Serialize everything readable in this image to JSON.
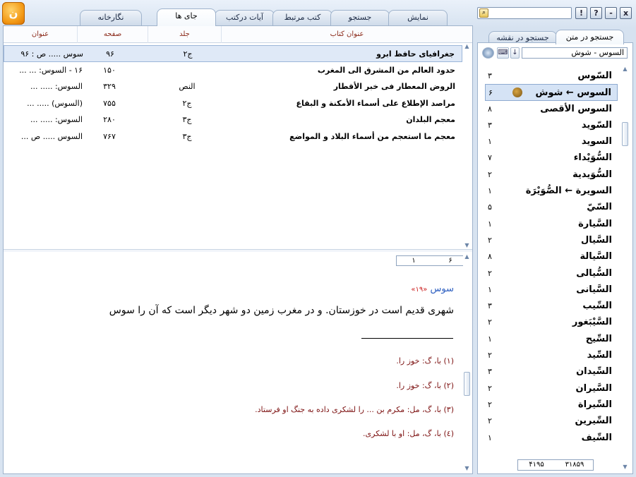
{
  "topbar": {
    "tabs": [
      {
        "label": "نمایش"
      },
      {
        "label": "جستجو"
      },
      {
        "label": "کتب مرتبط"
      },
      {
        "label": "آیات درکتب"
      },
      {
        "label": "جای ها"
      },
      {
        "label": "نگارخانه"
      }
    ],
    "search_placeholder": "",
    "buttons": {
      "info": "!",
      "help": "?",
      "minimize": "-",
      "close": "x"
    }
  },
  "table": {
    "columns": {
      "heading": "عنوان",
      "page": "صفحه",
      "volume": "جلد",
      "book_title": "عنوان کتاب"
    },
    "rows": [
      {
        "title": "جغرافیای حافظ ابرو",
        "volume": "ج۲",
        "page": "۹۶",
        "heading": "سوس ..... ص : ۹۶",
        "selected": true
      },
      {
        "title": "حدود العالم من المشرق الی المغرب",
        "volume": "",
        "page": "۱۵۰",
        "heading": "۱۶ - السوس: ... ..."
      },
      {
        "title": "الروض المعطار فی خبر الأقطار",
        "volume": "النص",
        "page": "۳۲۹",
        "heading": "السوس: ..... ..."
      },
      {
        "title": "مراصد الإطلاع علی أسماء الأمكنة و البقاع",
        "volume": "ج۲",
        "page": "۷۵۵",
        "heading": "(السوس) ..... ..."
      },
      {
        "title": "معجم البلدان",
        "volume": "ج۳",
        "page": "۲۸۰",
        "heading": "السوس: ..... ..."
      },
      {
        "title": "معجم ما استعجم من أسماء البلاد و المواضع",
        "volume": "ج۳",
        "page": "۷۶۷",
        "heading": "السوس ..... ص ..."
      }
    ]
  },
  "pager": {
    "current": "۱",
    "total": "۶"
  },
  "article": {
    "title": "سوس",
    "ref": "«۱۹»",
    "body": "شهری قدیم است در خوزستان. و در مغرب زمین دو شهر دیگر است که آن را سوس",
    "footnotes": [
      "(۱) با، گ: خوز را.",
      "(۲) با، گ: خوز را.",
      "(۳) با، گ، مل: مکرم بن ... را لشکری داده به جنگ او فرستاد.",
      "(٤) با، گ، مل: او با لشکری."
    ]
  },
  "right": {
    "tabs": [
      {
        "label": "جستجو در متن"
      },
      {
        "label": "جستجو در نقشه"
      }
    ],
    "search_value": "السوس - شوش",
    "words": [
      {
        "word": "السّوس",
        "count": "۳"
      },
      {
        "word": "السوس ← شوش",
        "count": "۶",
        "selected": true
      },
      {
        "word": "السوس الأقصی",
        "count": "۸"
      },
      {
        "word": "السّوید",
        "count": "۳"
      },
      {
        "word": "السوید",
        "count": "۱"
      },
      {
        "word": "السُّوَیْداء",
        "count": "۷"
      },
      {
        "word": "السُّوَیدیة",
        "count": "۲"
      },
      {
        "word": "السویرة ← الصُّوَیْرَة",
        "count": "۱"
      },
      {
        "word": "السّيّ",
        "count": "۵"
      },
      {
        "word": "السَّیارة",
        "count": "۱"
      },
      {
        "word": "السَّیال",
        "count": "۲"
      },
      {
        "word": "السَّیالة",
        "count": "۸"
      },
      {
        "word": "السُّیالی",
        "count": "۲"
      },
      {
        "word": "السَّیانی",
        "count": "۱"
      },
      {
        "word": "السِّیب",
        "count": "۳"
      },
      {
        "word": "السَّیْبَغور",
        "count": "۲"
      },
      {
        "word": "السِّیح",
        "count": "۱"
      },
      {
        "word": "السِّید",
        "count": "۲"
      },
      {
        "word": "السِّیدان",
        "count": "۳"
      },
      {
        "word": "السَّیران",
        "count": "۲"
      },
      {
        "word": "السِّیراة",
        "count": "۲"
      },
      {
        "word": "السِّیرین",
        "count": "۲"
      },
      {
        "word": "السِّیف",
        "count": "۱"
      }
    ],
    "count_total": "۳۱۸۵۹",
    "count_found": "۴۱۹۵"
  }
}
